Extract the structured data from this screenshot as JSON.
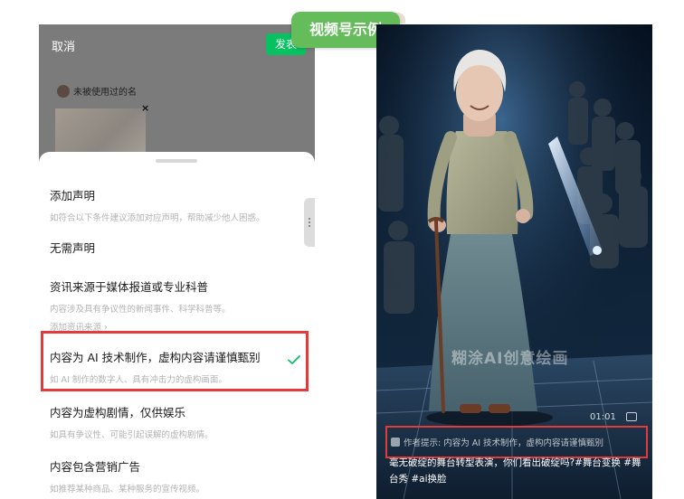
{
  "badge": {
    "label": "视频号示例"
  },
  "left_phone": {
    "cancel_label": "取消",
    "publish_label": "发表",
    "author_name": "未被使用过的名",
    "close_symbol": "×",
    "options": [
      {
        "title": "添加声明",
        "subtitle": "如符合以下条件建议添加对应声明，帮助减少他人困惑。"
      },
      {
        "title": "无需声明"
      },
      {
        "title": "资讯来源于媒体报道或专业科普",
        "subtitle": "内容涉及具有争议性的新闻事件、科学科普等。",
        "link": "添加资讯来源 ›"
      },
      {
        "title": "内容为 AI 技术制作，虚构内容请谨慎甄别",
        "subtitle": "如 AI 制作的数字人、具有冲击力的虚构画面。",
        "selected": true
      },
      {
        "title": "内容为虚构剧情，仅供娱乐",
        "subtitle": "如具有争议性、可能引起误解的虚构剧情。"
      },
      {
        "title": "内容包含营销广告",
        "subtitle": "如推荐某种商品、某种服务的宣传视频。"
      }
    ]
  },
  "video": {
    "watermark": "糊涂AI创意绘画",
    "timestamp": "01:01",
    "notice_text": "作者提示: 内容为 AI 技术制作，虚构内容请谨慎甄别",
    "caption": "毫无破绽的舞台转型表演，你们看出破绽吗?#舞台变换 #舞台秀 #ai换脸"
  },
  "colors": {
    "accent_green": "#07c160",
    "badge_green": "#64bd5a",
    "highlight_red": "#e53a3a"
  },
  "icons": [
    "avatar",
    "close-icon",
    "check-icon",
    "drawer-handle-icon",
    "notice-icon",
    "pip-icon"
  ]
}
